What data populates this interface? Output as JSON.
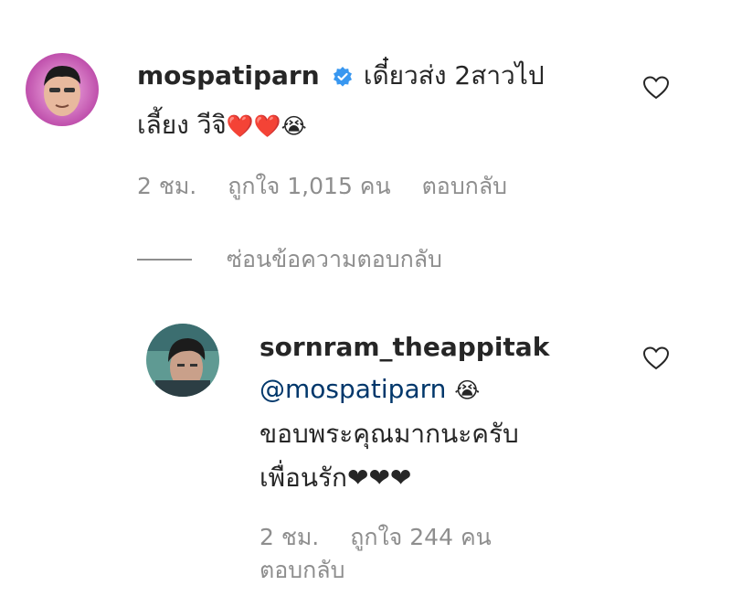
{
  "comment": {
    "username": "mospatiparn",
    "text_line1": "เดี๋ยวส่ง 2สาวไป",
    "text_line2": "เลี้ยง วีจิ",
    "emojis": "❤️❤️😭",
    "time": "2 ชม.",
    "likes": "ถูกใจ 1,015 คน",
    "reply_label": "ตอบกลับ",
    "hide_replies_label": "ซ่อนข้อความตอบกลับ",
    "verified_icon": "verified-badge-icon",
    "like_icon": "heart-outline-icon",
    "accent_color": "#3897f0"
  },
  "reply": {
    "username": "sornram_theappitak",
    "mention": "@mospatiparn",
    "mention_emoji": "😭",
    "text_line1": "ขอบพระคุณมากนะครับ",
    "text_line2": "เพื่อนรัก",
    "hearts": "❤❤❤",
    "time": "2 ชม.",
    "likes": "ถูกใจ 244 คน",
    "reply_label": "ตอบกลับ",
    "like_icon": "heart-outline-icon",
    "mention_color": "#00376b"
  }
}
